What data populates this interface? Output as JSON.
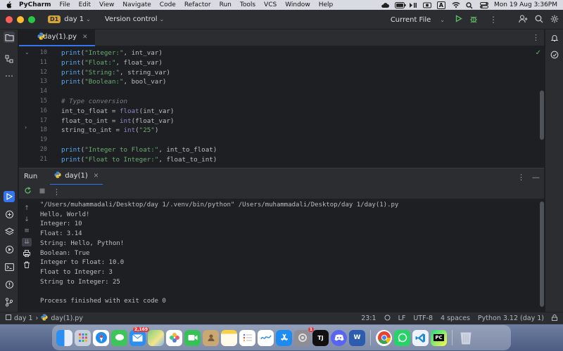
{
  "menubar": {
    "app_name": "PyCharm",
    "items": [
      "File",
      "Edit",
      "View",
      "Navigate",
      "Code",
      "Refactor",
      "Run",
      "Tools",
      "VCS",
      "Window",
      "Help"
    ],
    "input_source": "A",
    "clock": "Mon 19 Aug  3:36PM"
  },
  "toolbar": {
    "project_badge": "D1",
    "project_name": "day 1",
    "vcs_label": "Version control",
    "run_config": "Current File"
  },
  "editor": {
    "tab_label": "day(1).py",
    "lines": [
      {
        "n": "10",
        "segs": [
          [
            "fn",
            "print"
          ],
          [
            "p",
            "("
          ],
          [
            "str",
            "\"Integer:\""
          ],
          [
            "p",
            ", int_var)"
          ]
        ]
      },
      {
        "n": "11",
        "segs": [
          [
            "fn",
            "print"
          ],
          [
            "p",
            "("
          ],
          [
            "str",
            "\"Float:\""
          ],
          [
            "p",
            ", float_var)"
          ]
        ]
      },
      {
        "n": "12",
        "segs": [
          [
            "fn",
            "print"
          ],
          [
            "p",
            "("
          ],
          [
            "str",
            "\"String:\""
          ],
          [
            "p",
            ", string_var)"
          ]
        ]
      },
      {
        "n": "13",
        "segs": [
          [
            "fn",
            "print"
          ],
          [
            "p",
            "("
          ],
          [
            "str",
            "\"Boolean:\""
          ],
          [
            "p",
            ", bool_var)"
          ]
        ]
      },
      {
        "n": "14",
        "segs": []
      },
      {
        "n": "15",
        "segs": [
          [
            "cmt",
            "# Type conversion"
          ]
        ]
      },
      {
        "n": "16",
        "segs": [
          [
            "p",
            "int_to_float = "
          ],
          [
            "bi",
            "float"
          ],
          [
            "p",
            "(int_var)"
          ]
        ]
      },
      {
        "n": "17",
        "segs": [
          [
            "p",
            "float_to_int = "
          ],
          [
            "bi",
            "int"
          ],
          [
            "p",
            "(float_var)"
          ]
        ]
      },
      {
        "n": "18",
        "segs": [
          [
            "p",
            "string_to_int = "
          ],
          [
            "bi",
            "int"
          ],
          [
            "p",
            "("
          ],
          [
            "str",
            "\"25\""
          ],
          [
            "p",
            ")"
          ]
        ]
      },
      {
        "n": "19",
        "segs": []
      },
      {
        "n": "20",
        "segs": [
          [
            "fn",
            "print"
          ],
          [
            "p",
            "("
          ],
          [
            "str",
            "\"Integer to Float:\""
          ],
          [
            "p",
            ", int_to_float)"
          ]
        ]
      },
      {
        "n": "21",
        "segs": [
          [
            "fn",
            "print"
          ],
          [
            "p",
            "("
          ],
          [
            "str",
            "\"Float to Integer:\""
          ],
          [
            "p",
            ", float_to_int)"
          ]
        ]
      }
    ]
  },
  "run": {
    "title": "Run",
    "tab_label": "day(1)",
    "output": [
      "\"/Users/muhammadali/Desktop/day 1/.venv/bin/python\" /Users/muhammadali/Desktop/day 1/day(1).py",
      "Hello, World!",
      "Integer: 10",
      "Float: 3.14",
      "String: Hello, Python!",
      "Boolean: True",
      "Integer to Float: 10.0",
      "Float to Integer: 3",
      "String to Integer: 25",
      "",
      "Process finished with exit code 0"
    ]
  },
  "statusbar": {
    "breadcrumb_project": "day 1",
    "breadcrumb_file": "day(1).py",
    "position": "23:1",
    "line_sep": "LF",
    "encoding": "UTF-8",
    "indent": "4 spaces",
    "interpreter": "Python 3.12 (day 1)"
  },
  "dock": {
    "mail_badge": "2,169",
    "settings_badge": "1",
    "jetbrains_label": "TJ",
    "word_label": "W",
    "pycharm_label": "PC"
  },
  "colors": {
    "accent": "#3574f0",
    "string": "#6aab73",
    "function": "#56a8f5",
    "comment": "#7a7e85",
    "success": "#5fb865"
  }
}
